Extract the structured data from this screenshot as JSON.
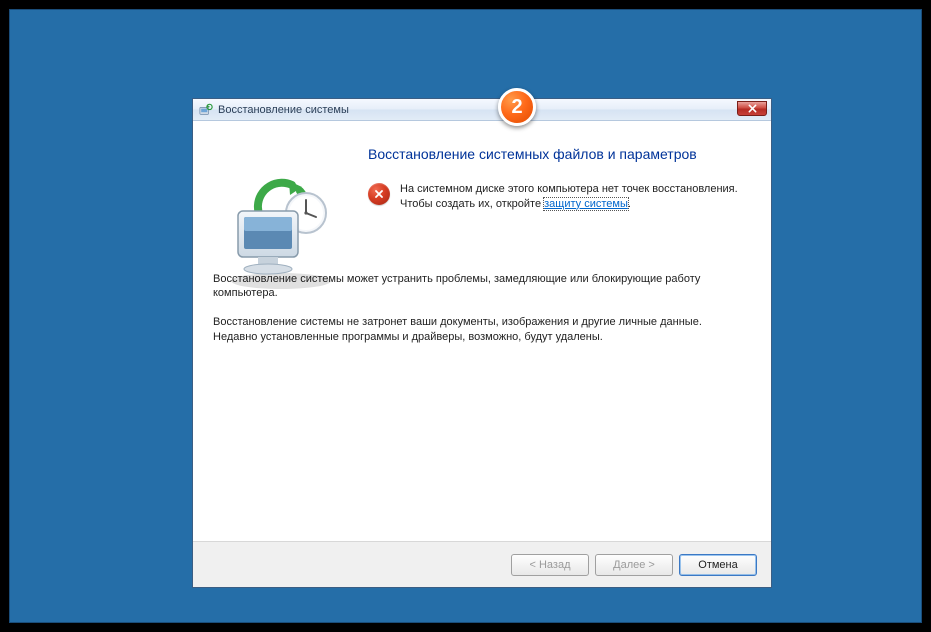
{
  "titlebar": {
    "title": "Восстановление системы"
  },
  "content": {
    "heading": "Восстановление системных файлов и параметров",
    "error_text_before_link": "На системном диске этого компьютера нет точек восстановления. Чтобы создать их, откройте ",
    "error_link_text": "защиту системы",
    "error_text_after_link": ".",
    "info1": "Восстановление системы может устранить проблемы, замедляющие или блокирующие работу компьютера.",
    "info2": "Восстановление системы не затронет ваши документы, изображения и другие личные данные. Недавно установленные программы и драйверы, возможно, будут удалены."
  },
  "footer": {
    "back_label": "< Назад",
    "next_label": "Далее >",
    "cancel_label": "Отмена"
  },
  "badge": {
    "number": "2"
  }
}
